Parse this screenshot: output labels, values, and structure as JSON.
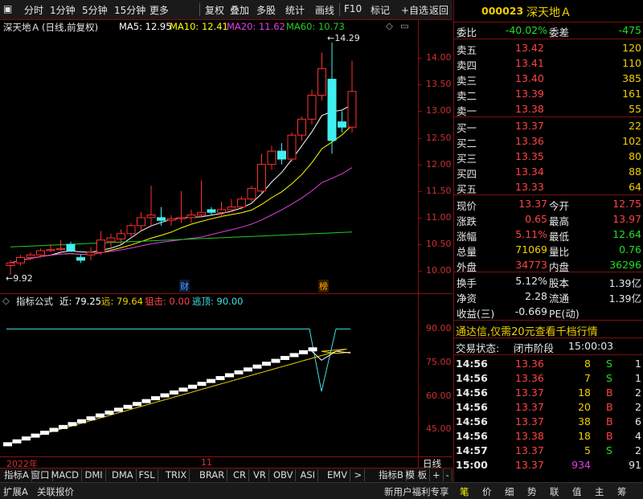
{
  "toolbar": {
    "items": [
      "分时",
      "1分钟",
      "5分钟",
      "15分钟",
      "更多",
      "复权",
      "叠加",
      "多股",
      "统计",
      "画线",
      "F10",
      "标记",
      "+自选",
      "返回"
    ],
    "selected": "更多"
  },
  "chart_header": {
    "name": "深天地Ａ",
    "mode": "(日线,前复权)",
    "ma5_label": "MA5:",
    "ma5": "12.95",
    "ma10_label": "MA10:",
    "ma10": "12.41",
    "ma20_label": "MA20:",
    "ma20": "11.62",
    "ma60_label": "MA60:",
    "ma60": "10.73"
  },
  "chart_annotations": {
    "high": "14.29",
    "low": "9.92",
    "marker_cai": "财",
    "marker_bang": "榜"
  },
  "indicator_header": {
    "name": "指标公式",
    "near_label": "近:",
    "near": "79.25",
    "far_label": "远:",
    "far": "79.64",
    "snipe_label": "狙击:",
    "snipe": "0.00",
    "escape_label": "逃顶:",
    "escape": "90.00"
  },
  "chart_data": [
    {
      "type": "candlestick",
      "title": "深天地Ａ (日线,前复权)",
      "y_ticks": [
        "14.00",
        "13.50",
        "13.00",
        "12.50",
        "12.00",
        "11.50",
        "11.00",
        "10.50",
        "10.00"
      ],
      "ylim": [
        9.7,
        14.5
      ],
      "ohlc": [
        [
          10.1,
          10.2,
          9.92,
          10.15
        ],
        [
          10.15,
          10.3,
          10.1,
          10.25
        ],
        [
          10.25,
          10.35,
          10.2,
          10.3
        ],
        [
          10.3,
          10.42,
          10.25,
          10.38
        ],
        [
          10.38,
          10.5,
          10.35,
          10.4
        ],
        [
          10.4,
          10.58,
          10.38,
          10.42
        ],
        [
          10.5,
          10.55,
          10.35,
          10.38
        ],
        [
          10.25,
          10.3,
          10.15,
          10.2
        ],
        [
          10.3,
          10.45,
          10.2,
          10.35
        ],
        [
          10.35,
          10.75,
          10.3,
          10.58
        ],
        [
          10.55,
          10.7,
          10.45,
          10.62
        ],
        [
          10.6,
          10.78,
          10.5,
          10.7
        ],
        [
          10.7,
          10.9,
          10.65,
          10.85
        ],
        [
          10.85,
          11.1,
          10.75,
          11.0
        ],
        [
          11.0,
          11.6,
          10.85,
          11.05
        ],
        [
          11.0,
          11.2,
          10.85,
          10.95
        ],
        [
          10.95,
          11.05,
          10.85,
          10.98
        ],
        [
          10.98,
          11.5,
          10.9,
          11.0
        ],
        [
          11.0,
          11.15,
          10.9,
          11.05
        ],
        [
          11.05,
          11.7,
          11.0,
          11.1
        ],
        [
          11.15,
          11.2,
          11.05,
          11.1
        ],
        [
          11.1,
          11.3,
          11.0,
          11.15
        ],
        [
          11.15,
          11.35,
          11.1,
          11.2
        ],
        [
          11.2,
          11.4,
          11.15,
          11.35
        ],
        [
          11.35,
          11.6,
          11.3,
          11.55
        ],
        [
          11.5,
          12.2,
          11.45,
          12.0
        ],
        [
          12.0,
          12.35,
          11.9,
          12.25
        ],
        [
          12.25,
          12.4,
          12.0,
          12.1
        ],
        [
          12.1,
          12.6,
          12.05,
          12.55
        ],
        [
          12.55,
          12.9,
          12.45,
          12.85
        ],
        [
          12.85,
          13.4,
          12.75,
          13.3
        ],
        [
          13.3,
          14.1,
          13.2,
          13.8
        ],
        [
          13.6,
          14.29,
          12.2,
          12.45
        ],
        [
          12.8,
          13.0,
          12.6,
          12.7
        ],
        [
          12.7,
          13.95,
          12.6,
          13.37
        ]
      ],
      "series": [
        {
          "name": "MA5",
          "value": 12.95,
          "color": "#ffffff"
        },
        {
          "name": "MA10",
          "value": 12.41,
          "color": "#ffff00"
        },
        {
          "name": "MA20",
          "value": 11.62,
          "color": "#e040e0"
        },
        {
          "name": "MA60",
          "value": 10.73,
          "color": "#22cc22"
        }
      ]
    },
    {
      "type": "line",
      "title": "指标公式",
      "y_ticks": [
        "90.00",
        "75.00",
        "60.00",
        "45.00"
      ],
      "ylim": [
        35,
        97
      ],
      "series": [
        {
          "name": "近",
          "value": 79.25,
          "color": "#ffffff"
        },
        {
          "name": "远",
          "value": 79.64,
          "color": "#f0d000"
        },
        {
          "name": "狙击",
          "value": 0.0,
          "color": "#ff4444"
        },
        {
          "name": "逃顶",
          "value": 90.0,
          "color": "#40e0e0"
        }
      ]
    }
  ],
  "time_axis": {
    "year": "2022年",
    "month": "11",
    "period": "日线"
  },
  "indicator_tabs": [
    "指标A",
    "窗口",
    "MACD",
    "DMI",
    "DMA",
    "FSL",
    "TRIX",
    "BRAR",
    "CR",
    "VR",
    "OBV",
    "ASI",
    "EMV",
    ">",
    "指标B",
    "模 板",
    "+",
    "-"
  ],
  "status_strip": {
    "left": [
      "扩展A",
      "关联报价"
    ],
    "promo": "新用户福利专享",
    "tabs": [
      "笔",
      "价",
      "细",
      "势",
      "联",
      "值",
      "主",
      "筹"
    ]
  },
  "quote": {
    "code": "000023",
    "name": "深天地Ａ",
    "weibi_label": "委比",
    "weibi": "-40.02%",
    "weicha_label": "委差",
    "weicha": "-475",
    "asks": [
      {
        "label": "卖五",
        "price": "13.42",
        "vol": "120"
      },
      {
        "label": "卖四",
        "price": "13.41",
        "vol": "110"
      },
      {
        "label": "卖三",
        "price": "13.40",
        "vol": "385"
      },
      {
        "label": "卖二",
        "price": "13.39",
        "vol": "161"
      },
      {
        "label": "卖一",
        "price": "13.38",
        "vol": "55"
      }
    ],
    "bids": [
      {
        "label": "买一",
        "price": "13.37",
        "vol": "22"
      },
      {
        "label": "买二",
        "price": "13.36",
        "vol": "102"
      },
      {
        "label": "买三",
        "price": "13.35",
        "vol": "80"
      },
      {
        "label": "买四",
        "price": "13.34",
        "vol": "88"
      },
      {
        "label": "买五",
        "price": "13.33",
        "vol": "64"
      }
    ],
    "stats": [
      {
        "l1": "现价",
        "v1": "13.37",
        "l2": "今开",
        "v2": "12.75",
        "c1": "red",
        "c2": "red"
      },
      {
        "l1": "涨跌",
        "v1": "0.65",
        "l2": "最高",
        "v2": "13.97",
        "c1": "red",
        "c2": "red"
      },
      {
        "l1": "涨幅",
        "v1": "5.11%",
        "l2": "最低",
        "v2": "12.64",
        "c1": "red",
        "c2": "green"
      },
      {
        "l1": "总量",
        "v1": "71069",
        "l2": "量比",
        "v2": "0.76",
        "c1": "yellow",
        "c2": "green"
      },
      {
        "l1": "外盘",
        "v1": "34773",
        "l2": "内盘",
        "v2": "36296",
        "c1": "red",
        "c2": "green"
      }
    ],
    "stats2": [
      {
        "l1": "换手",
        "v1": "5.12%",
        "l2": "股本",
        "v2": "1.39亿"
      },
      {
        "l1": "净资",
        "v1": "2.28",
        "l2": "流通",
        "v2": "1.39亿"
      },
      {
        "l1": "收益(三)",
        "v1": "-0.669",
        "l2": "PE(动)",
        "v2": ""
      }
    ],
    "promo": "通达信,仅需20元查看千档行情",
    "trade_status_label": "交易状态:",
    "trade_status": "闭市阶段",
    "trade_time": "15:00:03",
    "ticks": [
      {
        "time": "14:56",
        "price": "13.36",
        "vol": "8",
        "bs": "S",
        "n": "1"
      },
      {
        "time": "14:56",
        "price": "13.36",
        "vol": "7",
        "bs": "S",
        "n": "1"
      },
      {
        "time": "14:56",
        "price": "13.37",
        "vol": "18",
        "bs": "B",
        "n": "2"
      },
      {
        "time": "14:56",
        "price": "13.37",
        "vol": "20",
        "bs": "B",
        "n": "2"
      },
      {
        "time": "14:56",
        "price": "13.37",
        "vol": "38",
        "bs": "B",
        "n": "6"
      },
      {
        "time": "14:56",
        "price": "13.38",
        "vol": "18",
        "bs": "B",
        "n": "4"
      },
      {
        "time": "14:57",
        "price": "13.37",
        "vol": "5",
        "bs": "S",
        "n": "2"
      },
      {
        "time": "15:00",
        "price": "13.37",
        "vol": "934",
        "bs": "",
        "n": "91"
      }
    ]
  }
}
